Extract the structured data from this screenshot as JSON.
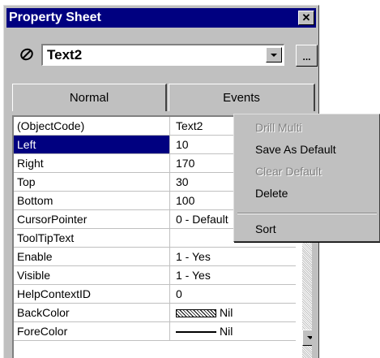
{
  "window": {
    "title": "Property Sheet"
  },
  "object_selector": {
    "value": "Text2",
    "builder_label": "..."
  },
  "tabs": [
    {
      "label": "Normal"
    },
    {
      "label": "Events"
    }
  ],
  "properties": [
    {
      "name": "(ObjectCode)",
      "value": "Text2"
    },
    {
      "name": "Left",
      "value": "10",
      "selected": true
    },
    {
      "name": "Right",
      "value": "170"
    },
    {
      "name": "Top",
      "value": "30"
    },
    {
      "name": "Bottom",
      "value": "100"
    },
    {
      "name": "CursorPointer",
      "value": "0 - Default"
    },
    {
      "name": "ToolTipText",
      "value": ""
    },
    {
      "name": "Enable",
      "value": "1 - Yes"
    },
    {
      "name": "Visible",
      "value": "1 - Yes"
    },
    {
      "name": "HelpContextID",
      "value": "0"
    },
    {
      "name": "BackColor",
      "value": "Nil"
    },
    {
      "name": "ForeColor",
      "value": "Nil"
    }
  ],
  "context_menu": {
    "items": [
      {
        "label": "Drill Multi",
        "enabled": false
      },
      {
        "label": "Save As Default",
        "enabled": true
      },
      {
        "label": "Clear Default",
        "enabled": false
      },
      {
        "label": "Delete",
        "enabled": true
      },
      {
        "label": "Sort",
        "enabled": true
      }
    ]
  },
  "colors": {
    "title_bar": "#000080",
    "selection": "#000080",
    "face": "#c0c0c0"
  }
}
